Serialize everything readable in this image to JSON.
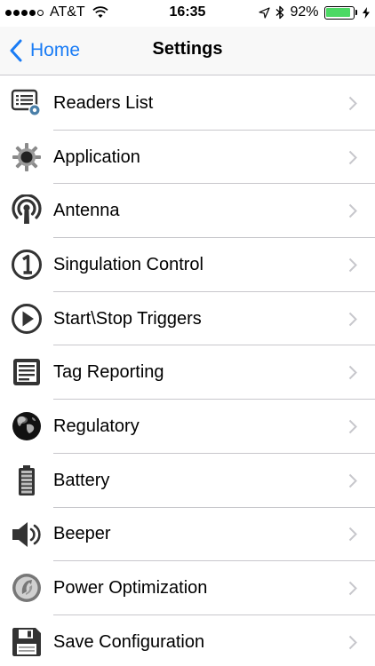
{
  "status_bar": {
    "carrier": "AT&T",
    "time": "16:35",
    "battery_percent": "92%",
    "battery_level": 0.92,
    "signal_bars_filled": 4,
    "signal_bars_total": 5,
    "battery_color": "#4cd964"
  },
  "nav": {
    "back_label": "Home",
    "title": "Settings",
    "accent_color": "#1a7cf5"
  },
  "menu": {
    "items": [
      {
        "label": "Readers List",
        "icon": "readers-list-icon"
      },
      {
        "label": "Application",
        "icon": "gear-icon"
      },
      {
        "label": "Antenna",
        "icon": "antenna-icon"
      },
      {
        "label": "Singulation Control",
        "icon": "number-one-icon"
      },
      {
        "label": "Start\\Stop Triggers",
        "icon": "play-icon"
      },
      {
        "label": "Tag Reporting",
        "icon": "report-icon"
      },
      {
        "label": "Regulatory",
        "icon": "globe-icon"
      },
      {
        "label": "Battery",
        "icon": "battery-icon"
      },
      {
        "label": "Beeper",
        "icon": "speaker-icon"
      },
      {
        "label": "Power Optimization",
        "icon": "power-optimization-icon"
      },
      {
        "label": "Save Configuration",
        "icon": "floppy-disk-icon"
      }
    ]
  }
}
